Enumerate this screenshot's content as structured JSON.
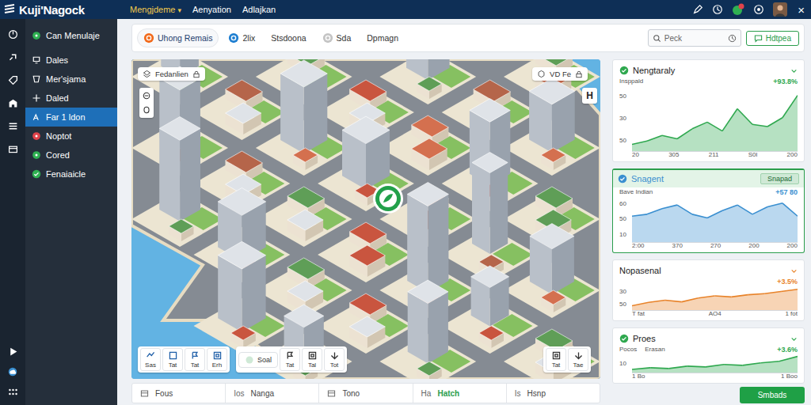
{
  "app": {
    "title": "Kuji'Nagock"
  },
  "top_menu": [
    {
      "label": "Mengjdeme",
      "caret": "▾",
      "selected": true
    },
    {
      "label": "Aenyation",
      "selected": false
    },
    {
      "label": "Adlajkan",
      "selected": false
    }
  ],
  "top_bar": {
    "close": "×"
  },
  "sidebar": {
    "items": [
      {
        "label": "Can Menulaje",
        "selected": false,
        "kind": "dot",
        "color": "#2fb152"
      },
      {
        "label": "Dales",
        "selected": false,
        "kind": "icon"
      },
      {
        "label": "Mer'sjama",
        "selected": false,
        "kind": "icon"
      },
      {
        "label": "Daled",
        "selected": false,
        "kind": "icon"
      },
      {
        "label": "Far 1 ldon",
        "selected": true,
        "kind": "icon"
      },
      {
        "label": "Noptot",
        "selected": false,
        "kind": "dot",
        "color": "#e0434b"
      },
      {
        "label": "Cored",
        "selected": false,
        "kind": "dot",
        "color": "#2fb152"
      },
      {
        "label": "Fenaiaicle",
        "selected": false,
        "kind": "check",
        "color": "#2fb152"
      }
    ]
  },
  "header": {
    "tabs": [
      {
        "label": "Uhong Remais",
        "selected": true,
        "color": "#f26a1b"
      },
      {
        "label": "2lix",
        "selected": false,
        "color": "#1f7fd1"
      },
      {
        "label": "Stsdoona",
        "selected": false
      },
      {
        "label": "Sda",
        "selected": false,
        "color": "#c4c4c4"
      },
      {
        "label": "Dpmagn",
        "selected": false
      }
    ],
    "search": {
      "placeholder": "Peck"
    },
    "action": "Hdtpea"
  },
  "map": {
    "layer_badge": "Fedanlien",
    "view_pill": "VD Fe",
    "compass": "H",
    "toolbar": {
      "tools": [
        {
          "label": "Sas"
        },
        {
          "label": "Tat"
        },
        {
          "label": "Tat"
        },
        {
          "label": "Erh"
        }
      ],
      "filters": [
        {
          "label": "Soal",
          "kind": "pill"
        },
        {
          "label": "Tat",
          "kind": "icon"
        },
        {
          "label": "Tal",
          "kind": "icon"
        },
        {
          "label": "Tot",
          "kind": "icon"
        }
      ],
      "extras": [
        {
          "label": "Tat"
        },
        {
          "label": "Tae"
        }
      ]
    }
  },
  "bottom_tabs": [
    {
      "prefix": "",
      "label": "Fous",
      "selected": false
    },
    {
      "prefix": "Ios",
      "label": "Nanga",
      "selected": false
    },
    {
      "prefix": "",
      "label": "Tono",
      "selected": false
    },
    {
      "prefix": "Ha",
      "label": "Hatch",
      "selected": true
    },
    {
      "prefix": "Is",
      "label": "Hsnp",
      "selected": false
    }
  ],
  "cards": [
    {
      "title": "Nengtaraly",
      "selected": false,
      "caption": "Insppald",
      "change": "+93.8%",
      "color": "#2fa84f",
      "y_ticks": [
        "50",
        "30",
        "50"
      ],
      "x_ticks": [
        "20",
        "305",
        "211",
        "S0l",
        "200"
      ],
      "values": [
        6,
        9,
        14,
        11,
        20,
        26,
        18,
        38,
        24,
        22,
        30,
        50
      ]
    },
    {
      "title": "Snagent",
      "selected": true,
      "action": "Snapad",
      "caption": "Bave Indian",
      "change": "+57 80",
      "color": "#3a8fd0",
      "y_ticks": [
        "60",
        "50",
        "10"
      ],
      "x_ticks": [
        "2:00",
        "370",
        "270",
        "200",
        "200"
      ],
      "values": [
        28,
        30,
        36,
        40,
        30,
        26,
        34,
        40,
        30,
        38,
        42,
        28
      ]
    },
    {
      "title": "Nopasenal",
      "selected": false,
      "change": "+3.5%",
      "color": "#e8832a",
      "y_ticks": [
        "30",
        "50"
      ],
      "x_ticks": [
        "T fat",
        "AO4",
        "1 fot"
      ],
      "values": [
        8,
        14,
        18,
        15,
        22,
        26,
        24,
        28,
        30,
        34,
        38
      ]
    },
    {
      "title": "Proes",
      "selected": false,
      "caption": "Pocos",
      "caption2": "Erasan",
      "change": "+3.6%",
      "color": "#2fa84f",
      "y_ticks": [
        "10"
      ],
      "x_ticks": [
        "1 Bo",
        "1 Boo"
      ],
      "values": [
        4,
        6,
        5,
        8,
        7,
        10,
        9,
        12,
        14,
        20
      ]
    }
  ],
  "footer_button": "Smbads"
}
